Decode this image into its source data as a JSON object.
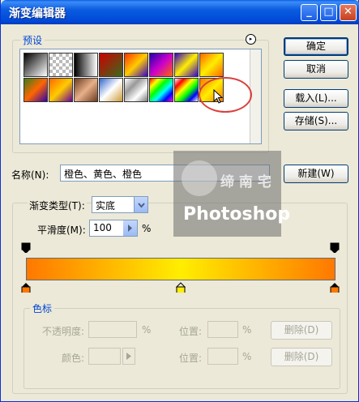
{
  "window": {
    "title": "渐变编辑器",
    "controls": {
      "minimize": "_",
      "maximize": "□",
      "close": "✕"
    }
  },
  "presets": {
    "group_label": "预设",
    "menu_icon": "▸"
  },
  "buttons": {
    "ok": "确定",
    "cancel": "取消",
    "load": "载入(L)...",
    "save": "存储(S)...",
    "new": "新建(W)"
  },
  "name": {
    "label": "名称(N):",
    "value": "橙色、黄色、橙色"
  },
  "gradient": {
    "type_label": "渐变类型(T):",
    "type_value": "实底",
    "smoothness_label": "平滑度(M):",
    "smoothness_value": "100",
    "smoothness_unit": "%"
  },
  "stops": {
    "group_label": "色标",
    "opacity_label": "不透明度:",
    "opacity_unit": "%",
    "position_label": "位置:",
    "position_unit": "%",
    "delete_label": "删除(D)",
    "color_label": "颜色:"
  },
  "watermark": {
    "text": "Photoshop",
    "script": "缔 南 宅"
  },
  "colors": {
    "orange": "#ff7800",
    "yellow": "#ffee00",
    "title_blue": "#0048d6",
    "group_label_blue": "#0046d5"
  }
}
